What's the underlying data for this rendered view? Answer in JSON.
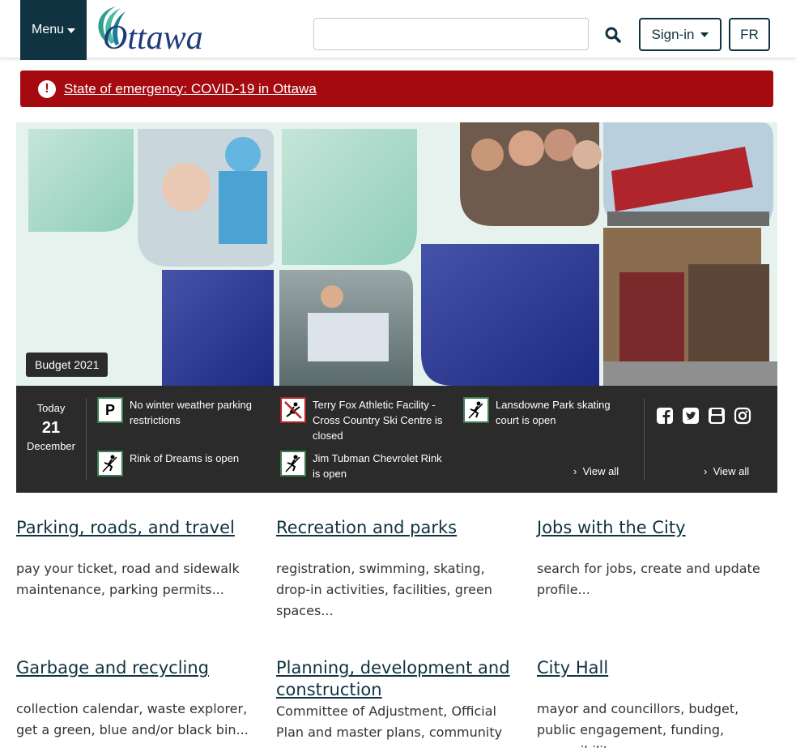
{
  "header": {
    "menu_label": "Menu",
    "logo_text": "Ottawa",
    "search_placeholder": "",
    "signin_label": "Sign-in",
    "lang_label": "FR"
  },
  "alert": {
    "text": "State of emergency: COVID-19 in Ottawa",
    "icon": "exclamation-icon"
  },
  "hero": {
    "badge": "Budget 2021"
  },
  "today": {
    "label": "Today",
    "day": "21",
    "month": "December"
  },
  "status_items": [
    {
      "icon": "parking-icon",
      "text": "No winter weather parking restrictions"
    },
    {
      "icon": "skier-closed-icon",
      "text": "Terry Fox Athletic Facility - Cross Country Ski Centre is closed"
    },
    {
      "icon": "skater-icon",
      "text": "Lansdowne Park skating court is open"
    },
    {
      "icon": "skater-icon",
      "text": "Rink of Dreams is open"
    },
    {
      "icon": "skater-icon",
      "text": "Jim Tubman Chevrolet Rink is open"
    }
  ],
  "view_all_1": "View all",
  "view_all_2": "View all",
  "social": [
    "facebook-icon",
    "twitter-icon",
    "youtube-icon",
    "instagram-icon"
  ],
  "categories": [
    {
      "title": "Parking, roads, and travel",
      "desc": "pay your ticket, road and sidewalk maintenance, parking permits..."
    },
    {
      "title": "Recreation and parks",
      "desc": "registration, swimming, skating, drop-in activities, facilities, green spaces..."
    },
    {
      "title": "Jobs with the City",
      "desc": "search for jobs, create and update profile..."
    },
    {
      "title": "Garbage and recycling",
      "desc": "collection calendar, waste explorer, get a green, blue and/or black bin..."
    },
    {
      "title": "Planning, development and construction",
      "desc": "Committee of Adjustment, Official Plan and master plans, community"
    },
    {
      "title": "City Hall",
      "desc": "mayor and councillors, budget, public engagement, funding, accessibility"
    }
  ]
}
